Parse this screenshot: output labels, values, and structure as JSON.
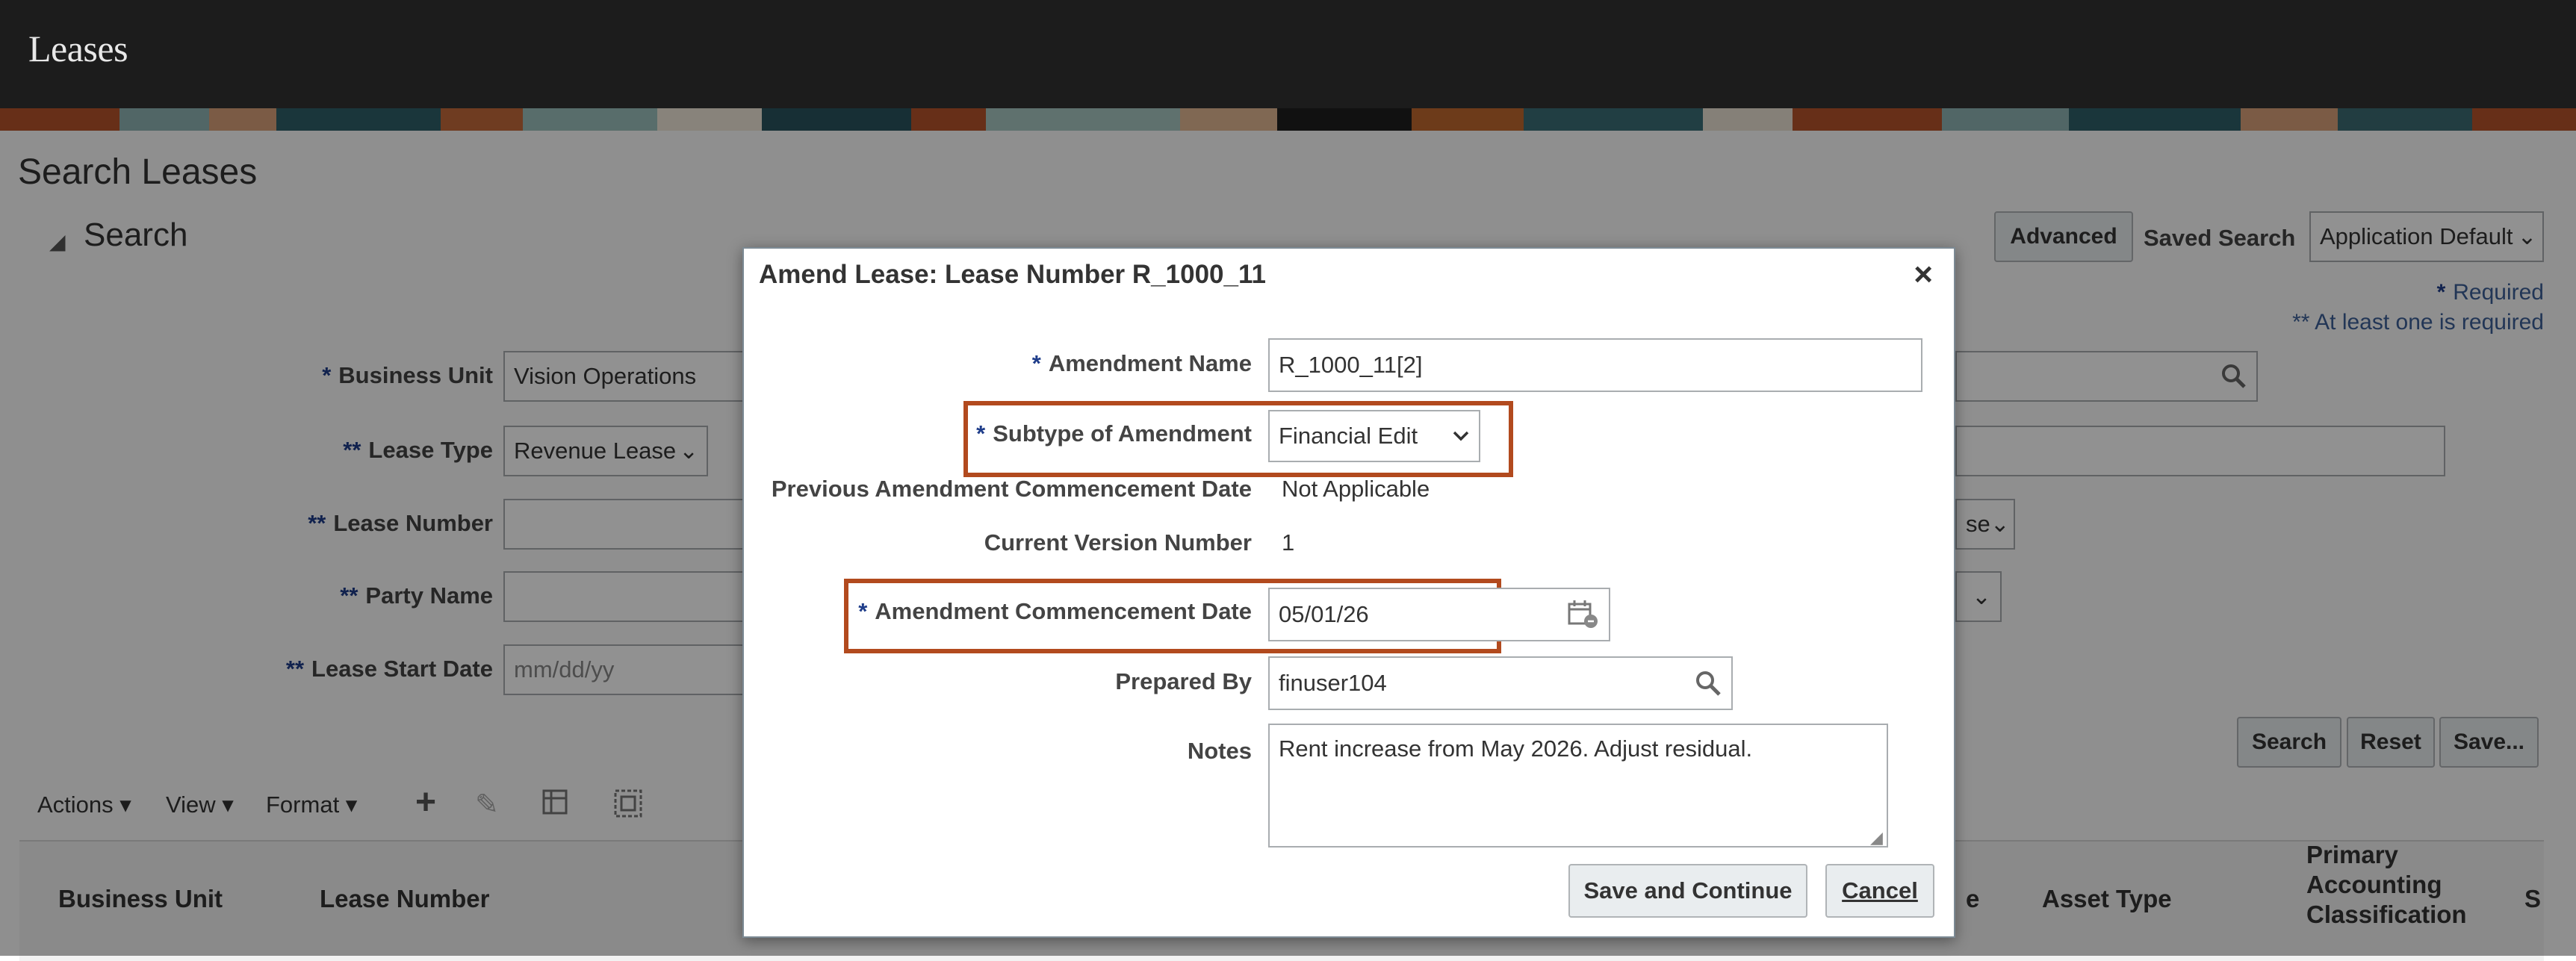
{
  "app": {
    "title": "Leases"
  },
  "page": {
    "title": "Search Leases",
    "search_header": "Search",
    "advanced_label": "Advanced",
    "saved_search_label": "Saved Search",
    "saved_search_value": "Application Default",
    "required_note": "Required",
    "at_least_one_note": "** At least one is required",
    "fields": {
      "business_unit": {
        "label": "Business Unit",
        "value": "Vision Operations"
      },
      "lease_type": {
        "label": "Lease Type",
        "value": "Revenue Lease"
      },
      "lease_number": {
        "label": "Lease Number",
        "value": ""
      },
      "party_name": {
        "label": "Party Name",
        "value": ""
      },
      "lease_start_date": {
        "label": "Lease Start Date",
        "placeholder": "mm/dd/yy"
      }
    },
    "partial_select_text": "se",
    "buttons": {
      "search": "Search",
      "reset": "Reset",
      "save": "Save..."
    },
    "toolbar": {
      "actions": "Actions",
      "view": "View",
      "format": "Format"
    },
    "columns": {
      "business_unit": "Business Unit",
      "lease_number": "Lease Number",
      "partial_e": "e",
      "asset_type": "Asset Type",
      "primary_1": "Primary",
      "primary_2": "Accounting",
      "primary_3": "Classification",
      "partial_s": "S"
    }
  },
  "dialog": {
    "title": "Amend Lease: Lease Number R_1000_11",
    "close": "×",
    "amendment_name": {
      "label": "Amendment Name",
      "value": "R_1000_11[2]"
    },
    "subtype": {
      "label": "Subtype of Amendment",
      "value": "Financial Edit"
    },
    "previous_commencement": {
      "label": "Previous Amendment Commencement Date",
      "value": "Not Applicable"
    },
    "current_version": {
      "label": "Current Version Number",
      "value": "1"
    },
    "commencement_date": {
      "label": "Amendment Commencement Date",
      "value": "05/01/26"
    },
    "prepared_by": {
      "label": "Prepared By",
      "value": "finuser104"
    },
    "notes": {
      "label": "Notes",
      "value": "Rent increase from May 2026. Adjust residual."
    },
    "save_continue": "Save and Continue",
    "cancel": "Cancel"
  },
  "colors": {
    "highlight": "#b24a1e",
    "required_star": "#1f3d8a",
    "topbar": "#1c1c1c"
  }
}
